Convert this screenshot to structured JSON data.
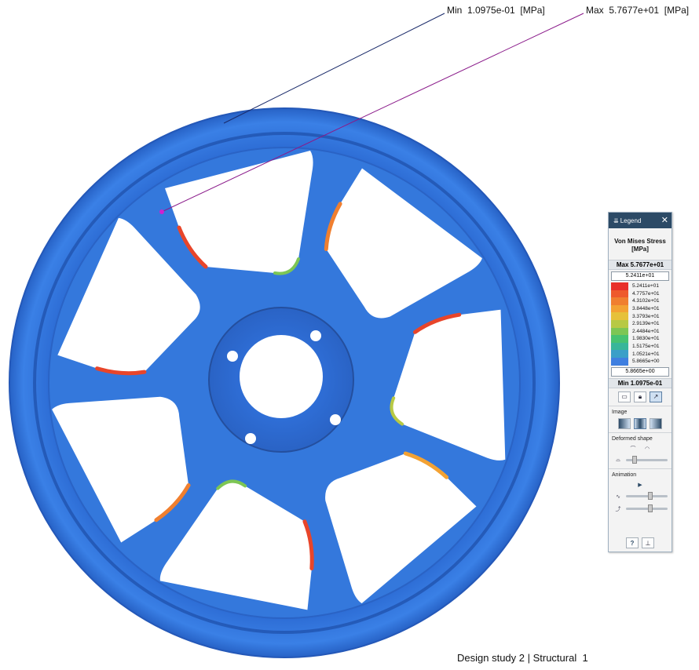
{
  "probes": {
    "min_label": "Min  1.0975e-01  [MPa]",
    "max_label": "Max  5.7677e+01  [MPa]"
  },
  "study_label": "Design study 2 | Structural  1",
  "legend": {
    "window_title": "Legend",
    "heading": "Von Mises Stress\n[MPa]",
    "max_text": "Max  5.7677e+01",
    "min_text": "Min  1.0975e-01",
    "top_value": "5.2411e+01",
    "bottom_value": "5.8665e+00",
    "scale": [
      {
        "value": "5.2411e+01",
        "color": "#e8302a"
      },
      {
        "value": "4.7757e+01",
        "color": "#ee5a2c"
      },
      {
        "value": "4.3102e+01",
        "color": "#f07f2f"
      },
      {
        "value": "3.8448e+01",
        "color": "#f3a233"
      },
      {
        "value": "3.3793e+01",
        "color": "#e6c13a"
      },
      {
        "value": "2.9139e+01",
        "color": "#b7c944"
      },
      {
        "value": "2.4484e+01",
        "color": "#7dc654"
      },
      {
        "value": "1.9830e+01",
        "color": "#47c271"
      },
      {
        "value": "1.5175e+01",
        "color": "#38b69a"
      },
      {
        "value": "1.0521e+01",
        "color": "#3a9fc8"
      },
      {
        "value": "5.8665e+00",
        "color": "#3f7fe0"
      }
    ],
    "sections": {
      "image": "Image",
      "deformed": "Deformed shape",
      "animation": "Animation"
    },
    "help_glyph": "?",
    "close_glyph": "✕",
    "play_glyph": "▶"
  },
  "colors": {
    "wheel_blue": "#2f6fd8",
    "accent_panel": "#2c4a66"
  }
}
